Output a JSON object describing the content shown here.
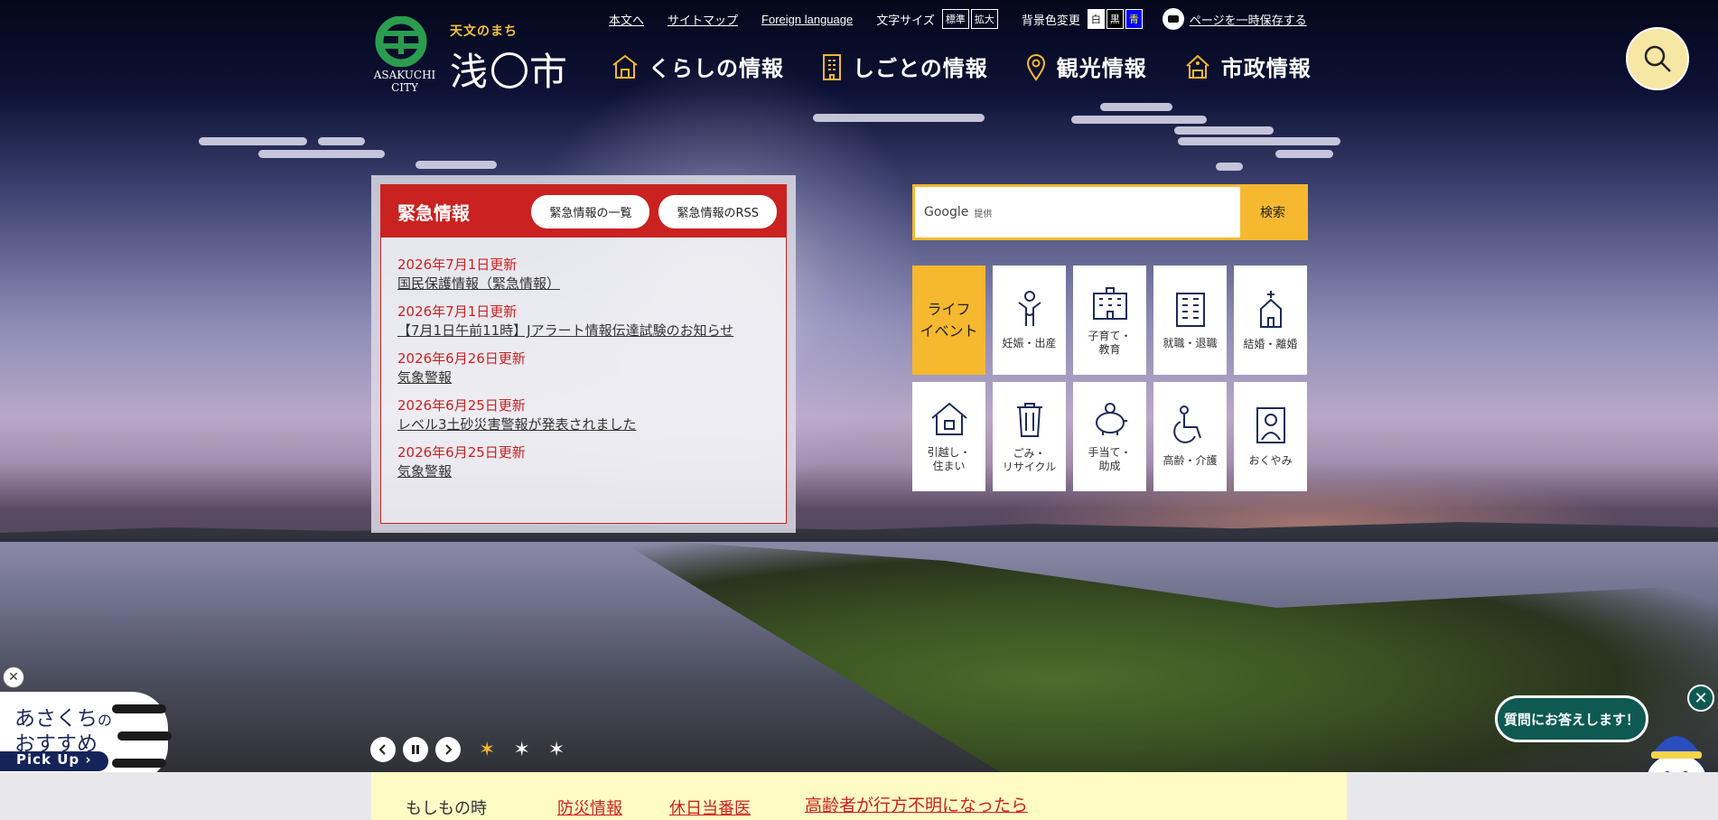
{
  "header": {
    "logo": {
      "tagline": "天文のまち",
      "name_left": "浅",
      "name_right": "市",
      "city_en_1": "ASAKUCHI",
      "city_en_2": "CITY"
    },
    "utility_links": [
      "本文へ",
      "サイトマップ",
      "Foreign language"
    ],
    "font_size": {
      "label": "文字サイズ",
      "standard": "標準",
      "large": "拡大"
    },
    "bg_color": {
      "label": "背景色変更",
      "white": "白",
      "black": "黒",
      "blue": "青"
    },
    "save_label": "ページを一時保存する",
    "nav": [
      "くらしの情報",
      "しごとの情報",
      "観光情報",
      "市政情報"
    ],
    "search_icon": "search-icon"
  },
  "emergency": {
    "title": "緊急情報",
    "list_button": "緊急情報の一覧",
    "rss_button": "緊急情報のRSS",
    "items": [
      {
        "date": "2026年7月1日更新",
        "text": "国民保護情報（緊急情報）"
      },
      {
        "date": "2026年7月1日更新",
        "text": "【7月1日午前11時】Jアラート情報伝達試験のお知らせ"
      },
      {
        "date": "2026年6月26日更新",
        "text": "気象警報"
      },
      {
        "date": "2026年6月25日更新",
        "text": "レベル3土砂災害警報が発表されました"
      },
      {
        "date": "2026年6月25日更新",
        "text": "気象警報"
      }
    ]
  },
  "search": {
    "brand": "Google",
    "provided": "提供",
    "button": "検索"
  },
  "life_events": {
    "title_1": "ライフ",
    "title_2": "イベント",
    "tiles": [
      {
        "l1": "妊娠・出産",
        "l2": "",
        "icon": "person-icon"
      },
      {
        "l1": "子育て・",
        "l2": "教育",
        "icon": "school-building-icon"
      },
      {
        "l1": "就職・退職",
        "l2": "",
        "icon": "office-building-icon"
      },
      {
        "l1": "結婚・離婚",
        "l2": "",
        "icon": "chapel-icon"
      },
      {
        "l1": "引越し・",
        "l2": "住まい",
        "icon": "house-icon"
      },
      {
        "l1": "ごみ・",
        "l2": "リサイクル",
        "icon": "trash-can-icon"
      },
      {
        "l1": "手当て・",
        "l2": "助成",
        "icon": "piggy-bank-icon"
      },
      {
        "l1": "高齢・介護",
        "l2": "",
        "icon": "wheelchair-icon"
      },
      {
        "l1": "おくやみ",
        "l2": "",
        "icon": "portrait-icon"
      }
    ]
  },
  "pickup": {
    "line1_a": "あさくち",
    "line1_b": "の",
    "line2": "おすすめ",
    "button": "Pick Up"
  },
  "chatbot": {
    "bubble": "質問にお答えします！"
  },
  "notice": {
    "top_link": "高齢者が行方不明になったら",
    "items": [
      "もしもの時",
      "防災情報",
      "休日当番医"
    ]
  },
  "colors": {
    "accent_red": "#c92220",
    "accent_yellow": "#f5b82e",
    "chat_green": "#0e5a52"
  }
}
